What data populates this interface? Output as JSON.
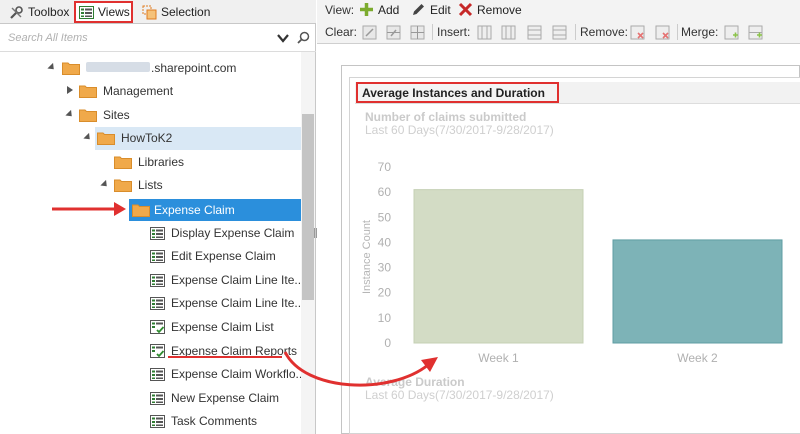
{
  "tabs": {
    "toolbox": "Toolbox",
    "views": "Views",
    "selection": "Selection"
  },
  "search": {
    "placeholder": "Search All Items"
  },
  "tree": {
    "site_suffix": ".sharepoint.com",
    "management": "Management",
    "sites": "Sites",
    "howtok2": "HowToK2",
    "libraries": "Libraries",
    "lists": "Lists",
    "expense_claim": "Expense Claim",
    "views": [
      "Display Expense Claim",
      "Edit Expense Claim",
      "Expense Claim Line Ite...",
      "Expense Claim Line Ite...",
      "Expense Claim List",
      "Expense Claim Reports",
      "Expense Claim Workflo...",
      "New Expense Claim",
      "Task Comments"
    ]
  },
  "toolbar": {
    "view_label": "View:",
    "add": "Add",
    "edit": "Edit",
    "remove": "Remove",
    "clear_label": "Clear:",
    "insert_label": "Insert:",
    "remove_label": "Remove:",
    "merge_label": "Merge:"
  },
  "report": {
    "title": "Average Instances and Duration",
    "subtitle1": "Number of claims submitted",
    "range1": "Last 60 Days(7/30/2017-9/28/2017)",
    "subtitle2": "Average Duration",
    "range2": "Last 60 Days(7/30/2017-9/28/2017)"
  },
  "chart_data": {
    "type": "bar",
    "title": "Number of claims submitted",
    "subtitle": "Last 60 Days(7/30/2017-9/28/2017)",
    "categories": [
      "Week 1",
      "Week 2"
    ],
    "values": [
      61,
      41
    ],
    "ylabel": "Instance Count",
    "xlabel": "",
    "ylim": [
      0,
      70
    ],
    "yticks": [
      0,
      10,
      20,
      30,
      40,
      50,
      60,
      70
    ],
    "grid": false,
    "colors": [
      "#d3dcc5",
      "#7db3b7"
    ]
  },
  "colors": {
    "highlight": "#e0302f",
    "selection": "#2b8fdc",
    "folder": "#f0a94a"
  }
}
